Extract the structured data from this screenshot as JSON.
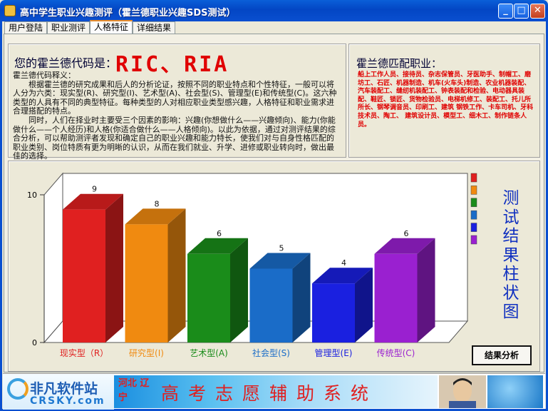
{
  "window": {
    "title": "高中学生职业兴趣测评（霍兰德职业兴趣SDS测试）",
    "minimize": "_",
    "maximize": "□",
    "close": "✕"
  },
  "tabs": [
    {
      "label": "用户登陆",
      "active": false
    },
    {
      "label": "职业测评",
      "active": false
    },
    {
      "label": "人格特征",
      "active": true
    },
    {
      "label": "详细结果",
      "active": false
    }
  ],
  "code_panel": {
    "label": "您的霍兰德代码是：",
    "value": "RIC、RIA",
    "explanation_title": "霍兰德代码释义：",
    "para1": "根据霍兰德的研究成果和后人的分析论证，按照不同的职业特点和个性特征，一般可以将人分为六类：现实型(R)、研究型(I)、艺术型(A)、社会型(S)、管理型(E)和传统型(C)。这六种类型的人具有不同的典型特征。每种类型的人对相应职业类型感兴趣，人格特征和职业需求进合理搭配的特点。",
    "para2": "同时，人们在择业时主要受三个因素的影响：兴趣(你想做什么——兴趣倾向)、能力(你能做什么——个人经历)和人格(你适合做什么——人格倾向)。以此为依据，通过对测评结果的综合分析，可以帮助测评者发现和确定自己的职业兴趣和能力特长，使我们对与自身性格匹配的职业类别、岗位特质有更为明晰的认识，从而在我们就业、升学、进修或职业转向时，做出最佳的选择。"
  },
  "match_panel": {
    "title": "霍兰德匹配职业：",
    "text": "船上工作人员、接待员、杂志保管员、牙医助手、制帽工、磨坊工、石匠、机器制造、机车(火车头)制造、农业机器装配、汽车装配工、缝纫机装配工、钟表装配和检验、电动器具装配、鞋匠、锁匠、货物检验员、电梯机修工、装配工、托儿所所长、钢琴调音员、印刷工、建筑 钢铁工作、卡车司机、牙科技术员、陶工、 建筑设计员、模型工、细木工、制作链条人员。"
  },
  "chart_data": {
    "type": "bar",
    "categories": [
      "现实型（R）",
      "研究型(I)",
      "艺术型(A)",
      "社会型(S)",
      "管理型(E)",
      "传统型(C)"
    ],
    "values": [
      9,
      8,
      6,
      5,
      4,
      6
    ],
    "colors": [
      "#e02020",
      "#f08a10",
      "#1a8c1a",
      "#1a6cc8",
      "#1a20e0",
      "#9a20d0"
    ],
    "yticks": [
      0,
      10
    ],
    "ylim": [
      0,
      10
    ],
    "legend_position": "right"
  },
  "side_title": "测试结果柱状图",
  "result_button": "结果分析",
  "banner": {
    "logo_cn": "非凡软件站",
    "logo_en": "CRSKY.com",
    "region": "河北 辽宁",
    "slogan": "高考志愿辅助系统"
  }
}
